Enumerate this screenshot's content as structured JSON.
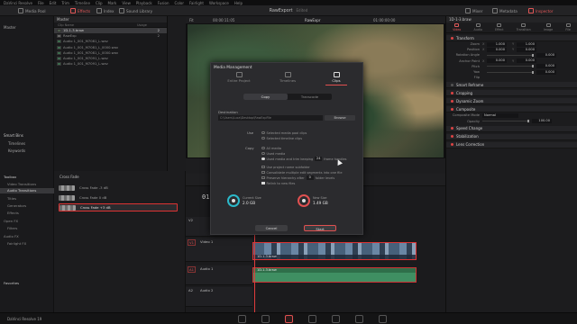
{
  "menu": [
    "DaVinci Resolve",
    "File",
    "Edit",
    "Trim",
    "Timeline",
    "Clip",
    "Mark",
    "View",
    "Playback",
    "Fusion",
    "Color",
    "Fairlight",
    "Workspace",
    "Help"
  ],
  "toolbar": {
    "media_pool": "Media Pool",
    "effects": "Effects",
    "index": "Index",
    "sound_library": "Sound Library",
    "project_title": "RawExport",
    "edited": "Edited",
    "mixer": "Mixer",
    "metadata": "Metadata",
    "inspector": "Inspector"
  },
  "bins": {
    "master": "Master",
    "smart_bins": "Smart Bins",
    "timelines": "Timelines",
    "keywords": "Keywords"
  },
  "media_pool": {
    "header": "Master",
    "col_name": "Clip Name",
    "col_usage": "Usage",
    "rows": [
      {
        "name": "1D-1-3.braw",
        "usage": "2"
      },
      {
        "name": "RawExp",
        "usage": "2"
      },
      {
        "name": "Audio 1_001_M7081_L.wav",
        "usage": ""
      },
      {
        "name": "Audio 1_001_M7081_L_0000.wav",
        "usage": ""
      },
      {
        "name": "Audio 1_001_M7081_L_0000.wav",
        "usage": ""
      },
      {
        "name": "Audio 1_001_M7091_L.wav",
        "usage": ""
      },
      {
        "name": "Audio 1_001_M7091_L.wav",
        "usage": ""
      }
    ]
  },
  "effects": {
    "toolbox": "Toolbox",
    "video_transitions": "Video Transitions",
    "audio_transitions": "Audio Transitions",
    "titles": "Titles",
    "generators": "Generators",
    "effects": "Effects",
    "open_fx": "Open FX",
    "filters": "Filters",
    "audio_fx": "Audio FX",
    "fairlight_fx": "Fairlight FX",
    "favorites": "Favorites",
    "category": "Cross Fade",
    "items": [
      "Cross Fade -3 dB",
      "Cross Fade 0 dB",
      "Cross Fade +3 dB"
    ]
  },
  "viewer": {
    "fit": "Fit",
    "timecode_left": "00:00:11:05",
    "clip_name": "RawExpr",
    "timecode_right": "01:00:00:00",
    "clip_right": "1D-1-3.braw"
  },
  "inspector": {
    "clip": "1D-1-3.braw",
    "tabs": [
      "Video",
      "Audio",
      "Effect",
      "Transition",
      "Image",
      "File"
    ],
    "transform": "Transform",
    "props": [
      {
        "k": "Zoom",
        "ax": "X",
        "v": "1.000",
        "ax2": "Y",
        "v2": "1.000"
      },
      {
        "k": "Position",
        "ax": "X",
        "v": "0.000",
        "ax2": "Y",
        "v2": "0.000"
      },
      {
        "k": "Rotation Angle",
        "v": "0.000"
      },
      {
        "k": "Anchor Point",
        "ax": "X",
        "v": "0.000",
        "ax2": "Y",
        "v2": "0.000"
      },
      {
        "k": "Pitch",
        "v": "0.000"
      },
      {
        "k": "Yaw",
        "v": "0.000"
      },
      {
        "k": "Flip",
        "v": ""
      }
    ],
    "smart_reframe": "Smart Reframe",
    "cropping": "Cropping",
    "dynamic_zoom": "Dynamic Zoom",
    "composite": "Composite",
    "composite_mode_label": "Composite Mode",
    "composite_mode": "Normal",
    "opacity_label": "Opacity",
    "opacity": "100.00",
    "speed_change": "Speed Change",
    "stabilization": "Stabilization",
    "lens_correction": "Lens Correction"
  },
  "timeline": {
    "timecode": "01",
    "tracks": [
      {
        "id": "V2",
        "name": "Video 2"
      },
      {
        "id": "V1",
        "name": "Video 1"
      },
      {
        "id": "A1",
        "name": "Audio 1"
      },
      {
        "id": "A2",
        "name": "Audio 2"
      }
    ],
    "video_clip": "1D-1-3.braw",
    "audio_clip": "1D-1-3.braw"
  },
  "modal": {
    "title": "Media Management",
    "tabs": [
      "Entire Project",
      "Timelines",
      "Clips"
    ],
    "active_tab": "Clips",
    "segments": [
      "Copy",
      "Transcode"
    ],
    "destination_label": "Destination",
    "destination_path": "C:\\Users\\Luca\\Desktop\\RawExpFile",
    "browse": "Browse",
    "use_label": "Use",
    "use_options": [
      "Selected media pool clips",
      "Selected timeline clips"
    ],
    "copy_label": "Copy",
    "copy_options": [
      "All media",
      "Used media",
      "Used media and trim keeping"
    ],
    "handles_value": "24",
    "handles_label": "frame handles",
    "checks": [
      {
        "label": "Use project name subfolder",
        "on": false
      },
      {
        "label": "Consolidate multiple edit segments into one file",
        "on": false
      },
      {
        "label": "Preserve hierarchy after",
        "on": false,
        "spin": "0",
        "suffix": "folder levels"
      },
      {
        "label": "Relink to new files",
        "on": true
      }
    ],
    "current_size_label": "Current Size",
    "current_size": "2.0 GB",
    "new_size_label": "New Size",
    "new_size": "1.49 GB",
    "cancel": "Cancel",
    "start": "Start"
  },
  "bottom": {
    "brand": "DaVinci Resolve 19"
  },
  "colors": {
    "accent": "#e05050",
    "clip_video": "#6a86a4",
    "clip_audio": "#3f8f62",
    "drive": "#2bb8c9"
  }
}
